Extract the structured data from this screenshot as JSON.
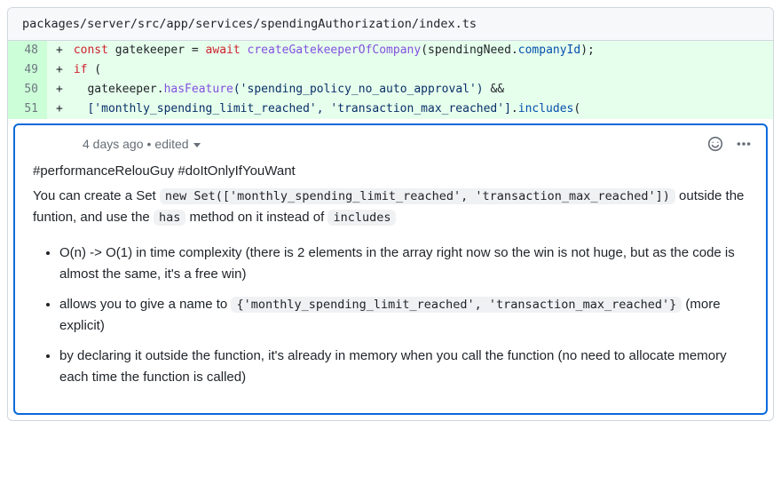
{
  "file": {
    "path": "packages/server/src/app/services/spendingAuthorization/index.ts"
  },
  "lines": {
    "l48": {
      "num": "48",
      "marker": "+"
    },
    "l49": {
      "num": "49",
      "marker": "+"
    },
    "l50": {
      "num": "50",
      "marker": "+"
    },
    "l51": {
      "num": "51",
      "marker": "+"
    }
  },
  "code": {
    "l48_const": "const",
    "l48_gate": " gatekeeper ",
    "l48_eq": "= ",
    "l48_await": "await",
    "l48_space": " ",
    "l48_fn": "createGatekeeperOfCompany",
    "l48_paren_open": "(",
    "l48_need": "spendingNeed",
    "l48_dot": ".",
    "l48_company": "companyId",
    "l48_paren_close": ");",
    "l49_if": "if",
    "l49_paren": " (",
    "l50_indent": "  gatekeeper.",
    "l50_has": "hasFeature",
    "l50_arg": "('spending_policy_no_auto_approval')",
    "l50_and": " &&",
    "l51_arr": "  ['monthly_spending_limit_reached', 'transaction_max_reached']",
    "l51_dot": ".",
    "l51_inc": "includes",
    "l51_paren": "("
  },
  "comment": {
    "time": "4 days ago",
    "dot": " • ",
    "edited": "edited",
    "tags": "#performanceRelouGuy #doItOnlyIfYouWant",
    "p1a": "You can create a Set ",
    "p1code1": "new Set(['monthly_spending_limit_reached', 'transaction_max_reached'])",
    "p1b": " outside the funtion, and use the ",
    "p1code2": "has",
    "p1c": " method on it instead of ",
    "p1code3": "includes",
    "b1": "O(n) -> O(1) in time complexity (there is 2 elements in the array right now so the win is not huge, but as the code is almost the same, it's a free win)",
    "b2a": "allows you to give a name to ",
    "b2code": "{'monthly_spending_limit_reached', 'transaction_max_reached'}",
    "b2b": " (more explicit)",
    "b3": "by declaring it outside the function, it's already in memory when you call the function (no need to allocate memory each time the function is called)"
  }
}
